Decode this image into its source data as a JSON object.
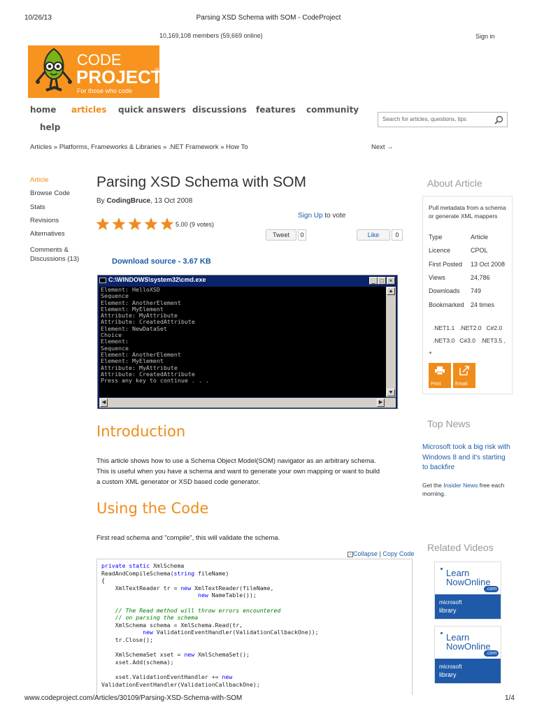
{
  "print": {
    "date": "10/26/13",
    "title": "Parsing XSD Schema with SOM - CodeProject",
    "url": "www.codeproject.com/Articles/30109/Parsing-XSD-Schema-with-SOM",
    "page": "1/4"
  },
  "header": {
    "members": "10,169,108 members (59,669 online)",
    "sign_in": "Sign in",
    "logo": {
      "code": "CODE",
      "project": "PROJECT",
      "tagline": "For those who code"
    }
  },
  "nav": {
    "items": [
      "home",
      "articles",
      "quick answers",
      "discussions",
      "features",
      "community",
      "help"
    ],
    "active": "articles"
  },
  "search": {
    "placeholder": "Search for articles, questions, tips"
  },
  "breadcrumb": {
    "text": "Articles » Platforms, Frameworks & Libraries » .NET Framework » How To",
    "next": "Next →"
  },
  "left_menu": [
    "Article",
    "Browse Code",
    "Stats",
    "Revisions",
    "Alternatives",
    "Comments &",
    "Discussions (13)"
  ],
  "article": {
    "title": "Parsing XSD Schema with SOM",
    "by": "By",
    "author": "CodingBruce",
    "date": ", 13 Oct 2008",
    "rating": "5.00 (9 votes)",
    "stars": 5,
    "sign_up": "Sign Up",
    "to_vote": " to vote",
    "tweet": "Tweet",
    "tweet_count": "0",
    "like": "Like",
    "like_count": "0",
    "download": "Download source - 3.67 KB"
  },
  "cmd": {
    "title": "C:\\WINDOWS\\system32\\cmd.exe",
    "lines": [
      "Element: HelloXSD",
      "Sequence",
      "Element: AnotherElement",
      "Element: MyElement",
      "Attribute: MyAttribute",
      "Attribute: CreatedAttribute",
      "Element: NewDataSet",
      "Choice",
      "Element:",
      "Sequence",
      "Element: AnotherElement",
      "Element: MyElement",
      "Attribute: MyAttribute",
      "Attribute: CreatedAttribute",
      "Press any key to continue . . ."
    ]
  },
  "intro": {
    "heading": "Introduction",
    "line1": "This article shows how to use a Schema Object Model(SOM) navigator as an arbitrary schema.",
    "line2": "This is useful when you have a schema and want to generate your own mapping or want to build",
    "line3": "a custom XML generator or XSD based code generator."
  },
  "using": {
    "heading": "Using the Code",
    "text": "First read schema and \"compile\", this will validate the schema.",
    "collapse": "Collapse",
    "separator": " | ",
    "copy": "Copy Code"
  },
  "about": {
    "heading": "About Article",
    "description": "Pull metadata from a schema or generate XML mappers",
    "rows": [
      {
        "k": "Type",
        "v": "Article"
      },
      {
        "k": "Licence",
        "v": "CPOL"
      },
      {
        "k": "First Posted",
        "v": "13 Oct 2008"
      },
      {
        "k": "Views",
        "v": "24,786"
      },
      {
        "k": "Downloads",
        "v": "749"
      },
      {
        "k": "Bookmarked",
        "v": "24 times"
      }
    ],
    "tags_line1": ".NET1.1   .NET2.0   C#2.0",
    "tags_line2": ".NET3.0   C#3.0   .NET3.5 ,",
    "tags_more": "+",
    "print": "Print",
    "email": "Email"
  },
  "news": {
    "heading": "Top News",
    "link": "Microsoft took a big risk with Windows 8 and it's starting to backfire",
    "get_the": "Get the ",
    "insider": "Insider News",
    "free": " free each morning."
  },
  "videos": {
    "heading": "Related Videos",
    "learn": "Learn",
    "now_online": "NowOnline",
    "com": ".com",
    "microsoft": "microsoft",
    "library": "library"
  },
  "colors": {
    "accent": "#f08c19",
    "link": "#1a5ca8"
  }
}
